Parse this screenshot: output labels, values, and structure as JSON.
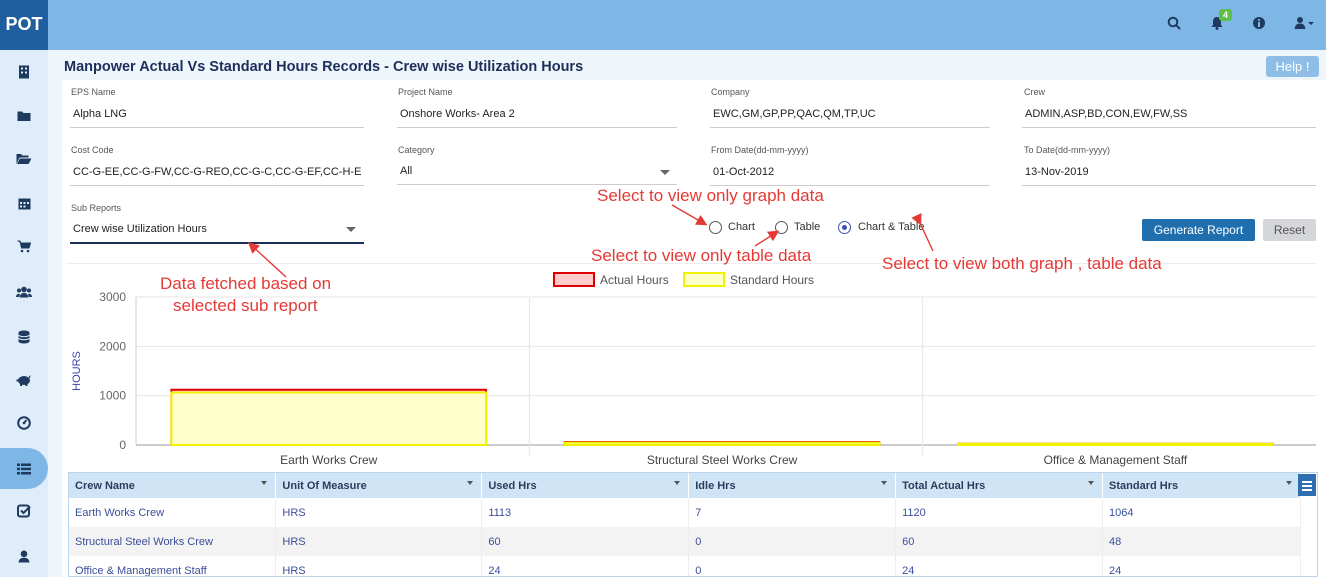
{
  "app": {
    "logo": "POT",
    "notification_count": "4"
  },
  "topbar_icons": [
    "search-icon",
    "bell-icon",
    "info-icon",
    "user-icon"
  ],
  "sidebar": [
    "building-icon",
    "folder-icon",
    "folder-open-icon",
    "calendar-icon",
    "cart-icon",
    "users-icon",
    "database-icon",
    "piggy-bank-icon",
    "dashboard-icon",
    "list-icon",
    "check-square-icon",
    "user-icon"
  ],
  "page": {
    "title": "Manpower Actual Vs Standard Hours Records - Crew wise Utilization Hours",
    "help_label": "Help !"
  },
  "filters": {
    "eps_label": "EPS Name",
    "eps_value": "Alpha LNG",
    "project_label": "Project Name",
    "project_value": "Onshore  Works- Area 2",
    "company_label": "Company",
    "company_value": "EWC,GM,GP,PP,QAC,QM,TP,UC",
    "crew_label": "Crew",
    "crew_value": "ADMIN,ASP,BD,CON,EW,FW,SS",
    "cost_label": "Cost Code",
    "cost_value": "CC-G-EE,CC-G-FW,CC-G-REO,CC-G-C,CC-G-EF,CC-H-E",
    "category_label": "Category",
    "category_value": "All",
    "from_label": "From Date(dd-mm-yyyy)",
    "from_value": "01-Oct-2012",
    "to_label": "To Date(dd-mm-yyyy)",
    "to_value": "13-Nov-2019",
    "sub_label": "Sub Reports",
    "sub_value": "Crew wise Utilization Hours"
  },
  "view_options": {
    "chart": "Chart",
    "table": "Table",
    "both": "Chart & Table",
    "selected": "both"
  },
  "buttons": {
    "generate": "Generate Report",
    "reset": "Reset"
  },
  "annotations": {
    "graph": "Select to view only graph data",
    "table": "Select to view only table data",
    "both": "Select to view both graph , table data",
    "sub1": "Data fetched based on",
    "sub2": "selected sub report"
  },
  "chart_data": {
    "type": "bar",
    "stacked": "overlay",
    "categories": [
      "Earth Works Crew",
      "Structural Steel  Works Crew",
      "Office & Management Staff"
    ],
    "series": [
      {
        "name": "Actual Hours",
        "values": [
          1120,
          60,
          24
        ],
        "color": "#ffcccc",
        "stroke": "#e00000"
      },
      {
        "name": "Standard Hours",
        "values": [
          1064,
          48,
          24
        ],
        "color": "#ffffcc",
        "stroke": "#f2f200"
      }
    ],
    "ylabel": "HOURS",
    "ylim": [
      0,
      3000
    ],
    "yticks": [
      "3000",
      "2000",
      "1000",
      "0"
    ],
    "legend": "top-center",
    "grid": true
  },
  "table": {
    "headers": [
      "Crew Name",
      "Unit Of Measure",
      "Used Hrs",
      "Idle Hrs",
      "Total Actual Hrs",
      "Standard Hrs"
    ],
    "rows": [
      [
        "Earth Works Crew",
        "HRS",
        "1113",
        "7",
        "1120",
        "1064"
      ],
      [
        "Structural Steel Works Crew",
        "HRS",
        "60",
        "0",
        "60",
        "48"
      ],
      [
        "Office & Management Staff",
        "HRS",
        "24",
        "0",
        "24",
        "24"
      ]
    ]
  }
}
